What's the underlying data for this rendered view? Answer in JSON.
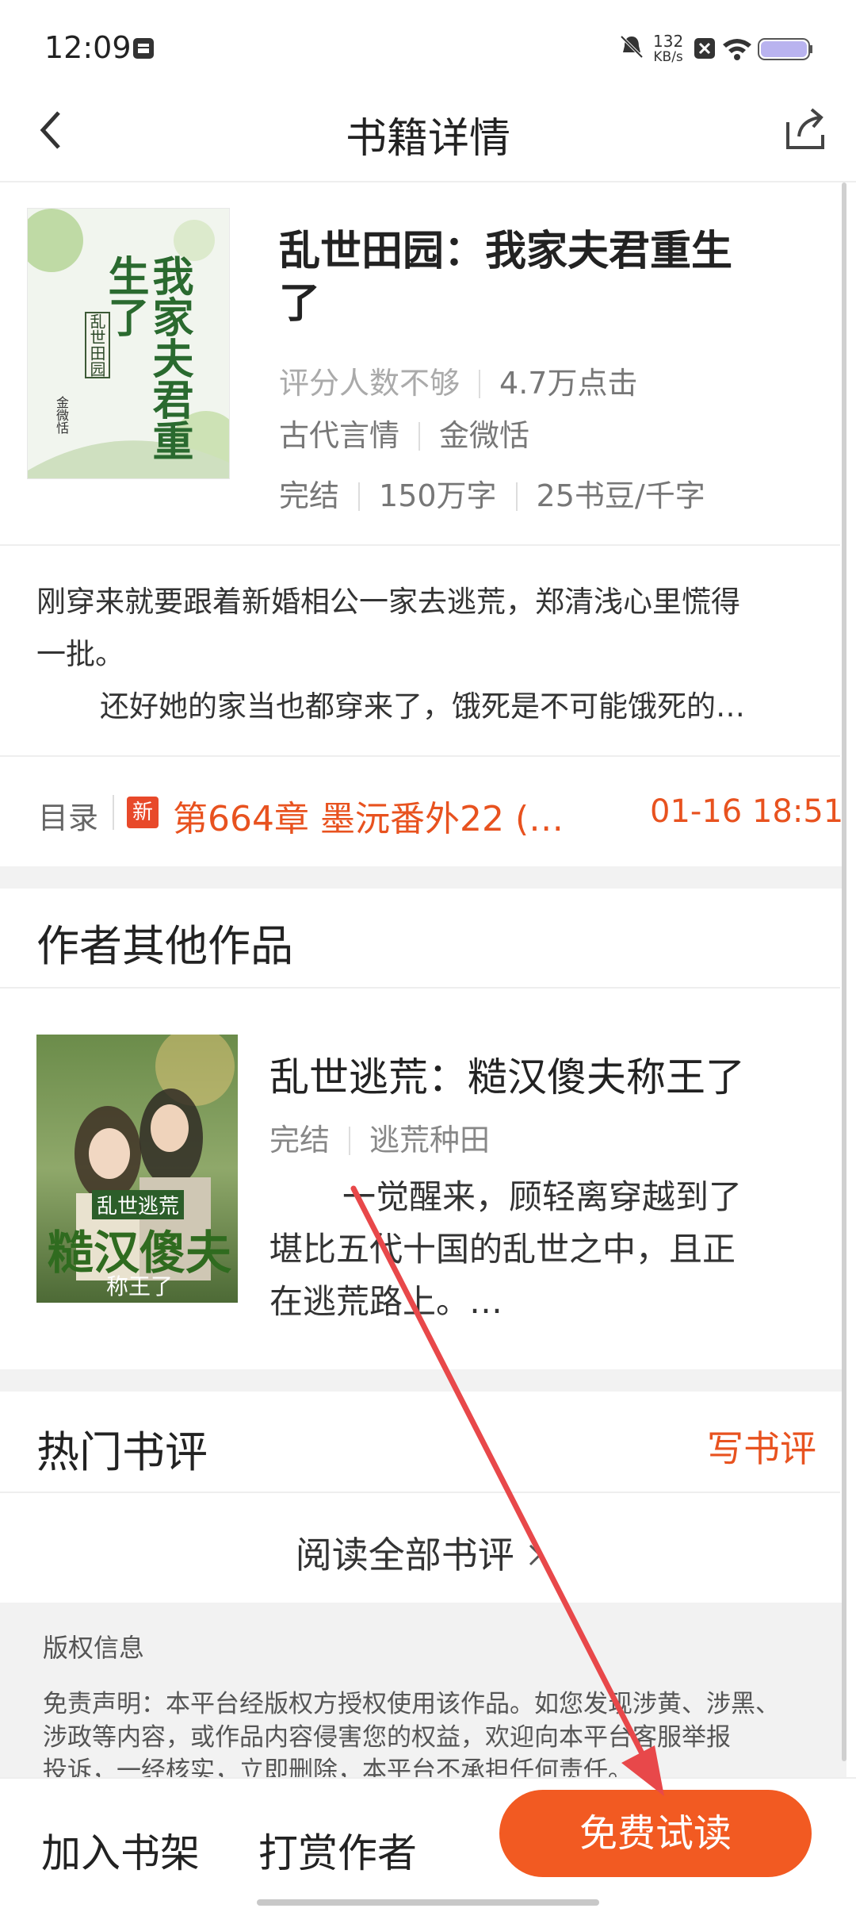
{
  "status_bar": {
    "time": "12:09",
    "net_speed_value": "132",
    "net_speed_unit": "KB/s"
  },
  "nav": {
    "title": "书籍详情"
  },
  "book": {
    "title_line1": "乱世田园：我家夫君重生",
    "title_line2": "了",
    "rating": "评分人数不够",
    "clicks": "4.7万点击",
    "genre": "古代言情",
    "author": "金微恬",
    "status": "完结",
    "word_count": "150万字",
    "price": "25书豆/千字",
    "cover_text": {
      "big": "我家夫君重生了",
      "series": "乱世田园",
      "author": "金微恬"
    }
  },
  "description": {
    "line1": "刚穿来就要跟着新婚相公一家去逃荒，郑清浅心里慌得",
    "line2": "一批。",
    "line3": "还好她的家当也都穿来了，饿死是不可能饿死的…"
  },
  "toc": {
    "label": "目录",
    "badge": "新",
    "latest_chapter": "第664章 墨沅番外22 (…",
    "time": "01-16 18:51"
  },
  "other_works": {
    "heading": "作者其他作品",
    "items": [
      {
        "title": "乱世逃荒：糙汉傻夫称王了",
        "status": "完结",
        "tag": "逃荒种田",
        "desc_line1": "一觉醒来，顾轻离穿越到了",
        "desc_line2": "堪比五代十国的乱世之中，且正",
        "desc_line3": "在逃荒路上。…",
        "cover_text": {
          "top": "乱世逃荒",
          "big": "糙汉傻夫",
          "sub": "称王了"
        }
      }
    ]
  },
  "reviews": {
    "heading": "热门书评",
    "write": "写书评",
    "read_all": "阅读全部书评"
  },
  "copyright": {
    "title": "版权信息",
    "line1": "免责声明：本平台经版权方授权使用该作品。如您发现涉黄、涉黑、",
    "line2": "涉政等内容，或作品内容侵害您的权益，欢迎向本平台客服举报",
    "line3": "投诉，一经核实，立即删除，本平台不承担任何责任。"
  },
  "bottom_bar": {
    "add_shelf": "加入书架",
    "tip_author": "打赏作者",
    "free_read": "免费试读"
  },
  "colors": {
    "accent": "#f25a22",
    "accent_text": "#e8521f",
    "annotation_arrow": "#e8484a"
  }
}
